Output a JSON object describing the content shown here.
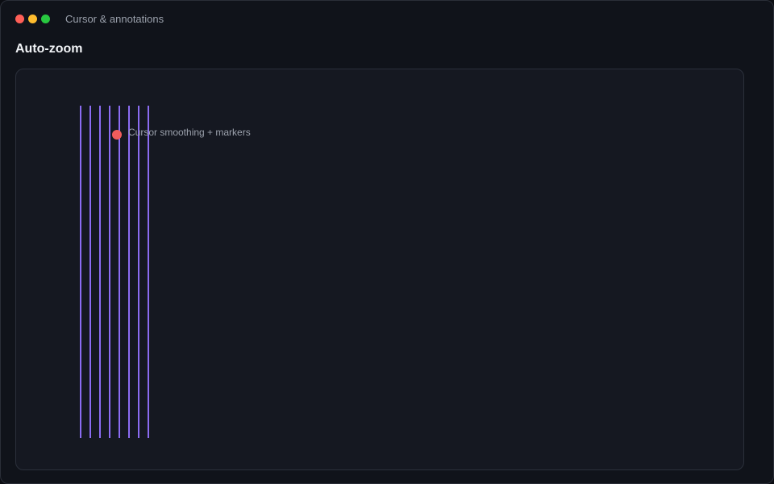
{
  "window": {
    "title": "Cursor & annotations",
    "controls": [
      "close",
      "minimize",
      "zoom"
    ],
    "colors": {
      "close": "#fe5f57",
      "minimize": "#febc2e",
      "zoom": "#28c840"
    }
  },
  "section": {
    "title": "Auto-zoom"
  },
  "canvas": {
    "track_color": "#8b6cf2",
    "track_count": 8,
    "cursor": {
      "color": "#f25c5c",
      "label": "Cursor smoothing + markers"
    }
  }
}
